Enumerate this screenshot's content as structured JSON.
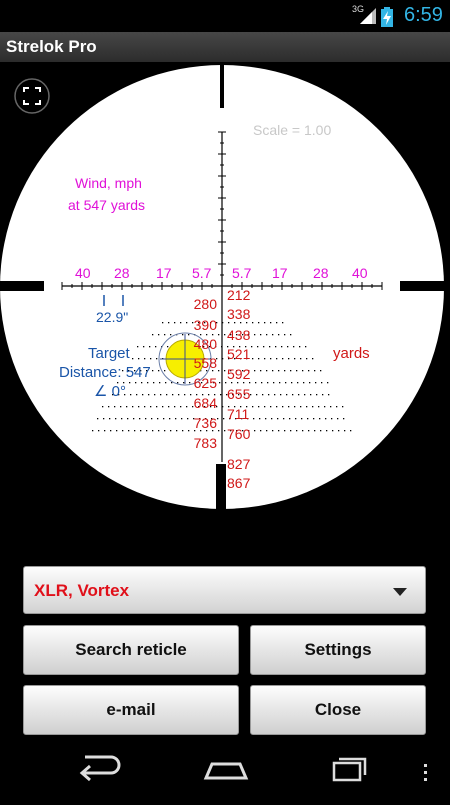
{
  "status_bar": {
    "network": "3G",
    "time": "6:59"
  },
  "app": {
    "title": "Strelok Pro"
  },
  "reticle": {
    "scale_label": "Scale = 1.00",
    "wind_label_line1": "Wind, mph",
    "wind_label_line2": "at 547 yards",
    "wind_values": [
      "40",
      "28",
      "17",
      "5.7",
      "5.7",
      "17",
      "28",
      "40"
    ],
    "wind_width_value": "22.9\"",
    "target_label": "Target",
    "distance_label": "Distance: 547",
    "angle_label": "∠ 0°",
    "units_label": "yards",
    "range_left": [
      "280",
      "390",
      "480",
      "558",
      "625",
      "684",
      "736",
      "783"
    ],
    "range_right": [
      "212",
      "338",
      "438",
      "521",
      "592",
      "655",
      "711",
      "760",
      "827",
      "867"
    ],
    "colors": {
      "wind": "#e010d8",
      "range": "#d01818",
      "info": "#1a55a8",
      "target": "#f7ef00"
    }
  },
  "controls": {
    "profile_value": "XLR, Vortex",
    "search_label": "Search reticle",
    "settings_label": "Settings",
    "email_label": "e-mail",
    "close_label": "Close"
  }
}
